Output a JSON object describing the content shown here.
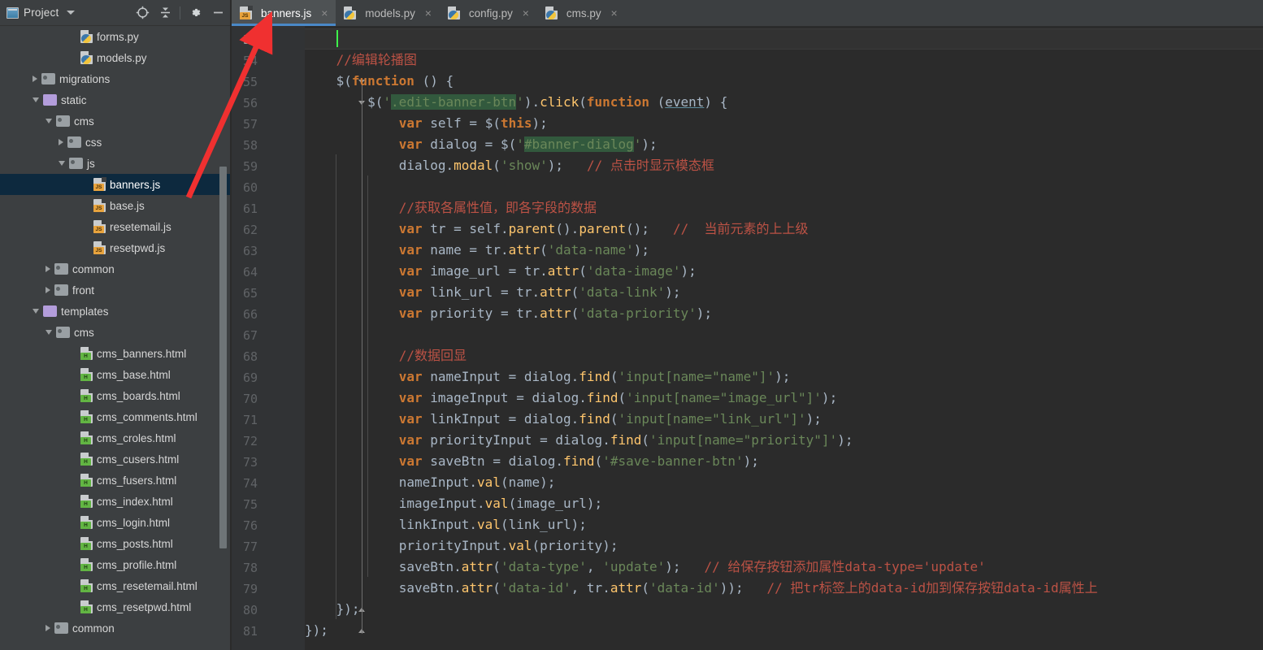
{
  "window": {
    "bg": "#3c3f41",
    "editor_bg": "#2b2b2b",
    "accent": "#4a88c7",
    "annotation_color": "#f03030"
  },
  "project_panel": {
    "title": "Project",
    "title_icon": "project-window-icon",
    "dropdown_icon": "chevron-down-icon",
    "toolbar_icons": [
      {
        "name": "locate-target-icon",
        "glyph": "target"
      },
      {
        "name": "collapse-all-icon",
        "glyph": "collapse"
      },
      {
        "name": "settings-gear-icon",
        "glyph": "gear"
      },
      {
        "name": "hide-panel-icon",
        "glyph": "minus"
      }
    ],
    "tree": [
      {
        "label": "forms.py",
        "indent": 5,
        "icon": "py",
        "twisty": "none",
        "selected": false
      },
      {
        "label": "models.py",
        "indent": 5,
        "icon": "py",
        "twisty": "none",
        "selected": false
      },
      {
        "label": "migrations",
        "indent": 2,
        "icon": "folder",
        "twisty": "collapsed",
        "selected": false
      },
      {
        "label": "static",
        "indent": 2,
        "icon": "folder-purple",
        "twisty": "expanded",
        "selected": false
      },
      {
        "label": "cms",
        "indent": 3,
        "icon": "folder",
        "twisty": "expanded",
        "selected": false
      },
      {
        "label": "css",
        "indent": 4,
        "icon": "folder",
        "twisty": "collapsed",
        "selected": false
      },
      {
        "label": "js",
        "indent": 4,
        "icon": "folder",
        "twisty": "expanded",
        "selected": false
      },
      {
        "label": "banners.js",
        "indent": 6,
        "icon": "js",
        "twisty": "none",
        "selected": true
      },
      {
        "label": "base.js",
        "indent": 6,
        "icon": "js",
        "twisty": "none",
        "selected": false
      },
      {
        "label": "resetemail.js",
        "indent": 6,
        "icon": "js",
        "twisty": "none",
        "selected": false
      },
      {
        "label": "resetpwd.js",
        "indent": 6,
        "icon": "js",
        "twisty": "none",
        "selected": false
      },
      {
        "label": "common",
        "indent": 3,
        "icon": "folder",
        "twisty": "collapsed",
        "selected": false
      },
      {
        "label": "front",
        "indent": 3,
        "icon": "folder",
        "twisty": "collapsed",
        "selected": false
      },
      {
        "label": "templates",
        "indent": 2,
        "icon": "folder-purple",
        "twisty": "expanded",
        "selected": false
      },
      {
        "label": "cms",
        "indent": 3,
        "icon": "folder",
        "twisty": "expanded",
        "selected": false
      },
      {
        "label": "cms_banners.html",
        "indent": 5,
        "icon": "html",
        "twisty": "none",
        "selected": false
      },
      {
        "label": "cms_base.html",
        "indent": 5,
        "icon": "html",
        "twisty": "none",
        "selected": false
      },
      {
        "label": "cms_boards.html",
        "indent": 5,
        "icon": "html",
        "twisty": "none",
        "selected": false
      },
      {
        "label": "cms_comments.html",
        "indent": 5,
        "icon": "html",
        "twisty": "none",
        "selected": false
      },
      {
        "label": "cms_croles.html",
        "indent": 5,
        "icon": "html",
        "twisty": "none",
        "selected": false
      },
      {
        "label": "cms_cusers.html",
        "indent": 5,
        "icon": "html",
        "twisty": "none",
        "selected": false
      },
      {
        "label": "cms_fusers.html",
        "indent": 5,
        "icon": "html",
        "twisty": "none",
        "selected": false
      },
      {
        "label": "cms_index.html",
        "indent": 5,
        "icon": "html",
        "twisty": "none",
        "selected": false
      },
      {
        "label": "cms_login.html",
        "indent": 5,
        "icon": "html",
        "twisty": "none",
        "selected": false
      },
      {
        "label": "cms_posts.html",
        "indent": 5,
        "icon": "html",
        "twisty": "none",
        "selected": false
      },
      {
        "label": "cms_profile.html",
        "indent": 5,
        "icon": "html",
        "twisty": "none",
        "selected": false
      },
      {
        "label": "cms_resetemail.html",
        "indent": 5,
        "icon": "html",
        "twisty": "none",
        "selected": false
      },
      {
        "label": "cms_resetpwd.html",
        "indent": 5,
        "icon": "html",
        "twisty": "none",
        "selected": false
      },
      {
        "label": "common",
        "indent": 3,
        "icon": "folder",
        "twisty": "collapsed",
        "selected": false
      }
    ]
  },
  "editor": {
    "tabs": [
      {
        "label": "banners.js",
        "icon": "js",
        "active": true,
        "close_glyph": "×"
      },
      {
        "label": "models.py",
        "icon": "py",
        "active": false,
        "close_glyph": "×"
      },
      {
        "label": "config.py",
        "icon": "py",
        "active": false,
        "close_glyph": "×"
      },
      {
        "label": "cms.py",
        "icon": "py",
        "active": false,
        "close_glyph": "×"
      }
    ],
    "first_line_number": 53,
    "caret_line": 53,
    "line_numbers": [
      53,
      54,
      55,
      56,
      57,
      58,
      59,
      60,
      61,
      62,
      63,
      64,
      65,
      66,
      67,
      68,
      69,
      70,
      71,
      72,
      73,
      74,
      75,
      76,
      77,
      78,
      79,
      80,
      81
    ],
    "lines": [
      {
        "n": 53,
        "text": ""
      },
      {
        "n": 54,
        "text": "    //编辑轮播图"
      },
      {
        "n": 55,
        "text": "    $(function () {"
      },
      {
        "n": 56,
        "text": "        $('.edit-banner-btn').click(function (event) {"
      },
      {
        "n": 57,
        "text": "            var self = $(this);"
      },
      {
        "n": 58,
        "text": "            var dialog = $('#banner-dialog');"
      },
      {
        "n": 59,
        "text": "            dialog.modal('show');   // 点击时显示模态框"
      },
      {
        "n": 60,
        "text": ""
      },
      {
        "n": 61,
        "text": "            //获取各属性值，即各字段的数据"
      },
      {
        "n": 62,
        "text": "            var tr = self.parent().parent();   //  当前元素的上上级"
      },
      {
        "n": 63,
        "text": "            var name = tr.attr('data-name');"
      },
      {
        "n": 64,
        "text": "            var image_url = tr.attr('data-image');"
      },
      {
        "n": 65,
        "text": "            var link_url = tr.attr('data-link');"
      },
      {
        "n": 66,
        "text": "            var priority = tr.attr('data-priority');"
      },
      {
        "n": 67,
        "text": ""
      },
      {
        "n": 68,
        "text": "            //数据回显"
      },
      {
        "n": 69,
        "text": "            var nameInput = dialog.find('input[name=\"name\"]');"
      },
      {
        "n": 70,
        "text": "            var imageInput = dialog.find('input[name=\"image_url\"]');"
      },
      {
        "n": 71,
        "text": "            var linkInput = dialog.find('input[name=\"link_url\"]');"
      },
      {
        "n": 72,
        "text": "            var priorityInput = dialog.find('input[name=\"priority\"]');"
      },
      {
        "n": 73,
        "text": "            var saveBtn = dialog.find('#save-banner-btn');"
      },
      {
        "n": 74,
        "text": "            nameInput.val(name);"
      },
      {
        "n": 75,
        "text": "            imageInput.val(image_url);"
      },
      {
        "n": 76,
        "text": "            linkInput.val(link_url);"
      },
      {
        "n": 77,
        "text": "            priorityInput.val(priority);"
      },
      {
        "n": 78,
        "text": "            saveBtn.attr('data-type', 'update');   // 给保存按钮添加属性data-type='update'"
      },
      {
        "n": 79,
        "text": "            saveBtn.attr('data-id', tr.attr('data-id'));   // 把tr标签上的data-id加到保存按钮data-id属性上"
      },
      {
        "n": 80,
        "text": "    });"
      },
      {
        "n": 81,
        "text": "});"
      }
    ],
    "search_highlights": [
      ".edit-banner-btn",
      "#banner-dialog"
    ],
    "syntax_colors": {
      "keyword": "#cc7832",
      "string": "#6a8759",
      "function": "#ffc66d",
      "identifier": "#a9b7c6",
      "comment_chinese": "#bc5245",
      "line_number": "#606366",
      "caret": "#3ef14b"
    }
  },
  "annotation": {
    "type": "red-arrow",
    "from_label": "banners.js",
    "to_label": "banners.js",
    "color": "#f03030"
  }
}
